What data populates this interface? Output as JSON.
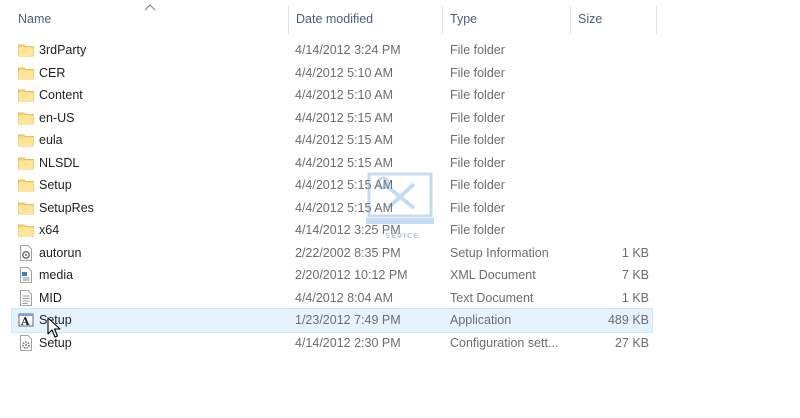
{
  "columns": {
    "name": "Name",
    "date": "Date modified",
    "type": "Type",
    "size": "Size"
  },
  "files": [
    {
      "name": "3rdParty",
      "date": "4/14/2012 3:24 PM",
      "type": "File folder",
      "size": "",
      "icon": "folder-icon"
    },
    {
      "name": "CER",
      "date": "4/4/2012 5:10 AM",
      "type": "File folder",
      "size": "",
      "icon": "folder-icon"
    },
    {
      "name": "Content",
      "date": "4/4/2012 5:10 AM",
      "type": "File folder",
      "size": "",
      "icon": "folder-icon"
    },
    {
      "name": "en-US",
      "date": "4/4/2012 5:15 AM",
      "type": "File folder",
      "size": "",
      "icon": "folder-icon"
    },
    {
      "name": "eula",
      "date": "4/4/2012 5:15 AM",
      "type": "File folder",
      "size": "",
      "icon": "folder-icon"
    },
    {
      "name": "NLSDL",
      "date": "4/4/2012 5:15 AM",
      "type": "File folder",
      "size": "",
      "icon": "folder-icon"
    },
    {
      "name": "Setup",
      "date": "4/4/2012 5:15 AM",
      "type": "File folder",
      "size": "",
      "icon": "folder-icon"
    },
    {
      "name": "SetupRes",
      "date": "4/4/2012 5:15 AM",
      "type": "File folder",
      "size": "",
      "icon": "folder-icon"
    },
    {
      "name": "x64",
      "date": "4/14/2012 3:25 PM",
      "type": "File folder",
      "size": "",
      "icon": "folder-icon"
    },
    {
      "name": "autorun",
      "date": "2/22/2002 8:35 PM",
      "type": "Setup Information",
      "size": "1 KB",
      "icon": "setup-info-icon"
    },
    {
      "name": "media",
      "date": "2/20/2012 10:12 PM",
      "type": "XML Document",
      "size": "7 KB",
      "icon": "xml-document-icon"
    },
    {
      "name": "MID",
      "date": "4/4/2012 8:04 AM",
      "type": "Text Document",
      "size": "1 KB",
      "icon": "text-document-icon"
    },
    {
      "name": "Setup",
      "date": "1/23/2012 7:49 PM",
      "type": "Application",
      "size": "489 KB",
      "icon": "application-icon",
      "selected": true
    },
    {
      "name": "Setup",
      "date": "4/14/2012 2:30 PM",
      "type": "Configuration sett...",
      "size": "27 KB",
      "icon": "config-settings-icon"
    }
  ],
  "watermark_text": "SEVICE",
  "colors": {
    "header_text": "#4c607a",
    "detail_text": "#6d6d6d",
    "selection_bg": "#e5f3ff",
    "folder_yellow": "#f8d775"
  }
}
